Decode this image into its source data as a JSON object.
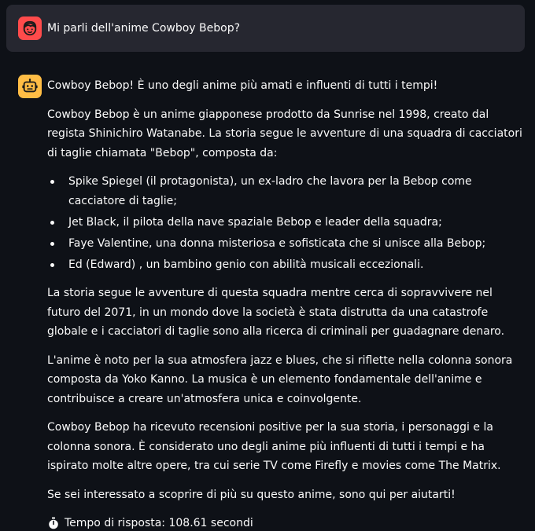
{
  "user_message": {
    "avatar_icon": "user-face-icon",
    "avatar_color": "#ff4b4b",
    "text": "Mi parli dell'anime Cowboy Bebop?"
  },
  "assistant_message": {
    "avatar_icon": "robot-face-icon",
    "avatar_color": "#ffbd45",
    "intro": "Cowboy Bebop! È uno degli anime più amati e influenti di tutti i tempi!",
    "paragraph_1": "Cowboy Bebop è un anime giapponese prodotto da Sunrise nel 1998, creato dal regista Shinichiro Watanabe. La storia segue le avventure di una squadra di cacciatori di taglie chiamata \"Bebop\", composta da:",
    "crew": [
      "Spike Spiegel (il protagonista), un ex-ladro che lavora per la Bebop come cacciatore di taglie;",
      "Jet Black, il pilota della nave spaziale Bebop e leader della squadra;",
      "Faye Valentine, una donna misteriosa e sofisticata che si unisce alla Bebop;",
      "Ed (Edward) , un bambino genio con abilità musicali eccezionali."
    ],
    "paragraph_2": "La storia segue le avventure di questa squadra mentre cerca di sopravvivere nel futuro del 2071, in un mondo dove la società è stata distrutta da una catastrofe globale e i cacciatori di taglie sono alla ricerca di criminali per guadagnare denaro.",
    "paragraph_3": "L'anime è noto per la sua atmosfera jazz e blues, che si riflette nella colonna sonora composta da Yoko Kanno. La musica è un elemento fondamentale dell'anime e contribuisce a creare un'atmosfera unica e coinvolgente.",
    "paragraph_4": "Cowboy Bebop ha ricevuto recensioni positive per la sua storia, i personaggi e la colonna sonora. È considerato uno degli anime più influenti di tutti i tempi e ha ispirato molte altre opere, tra cui serie TV come Firefly e movies come The Matrix.",
    "closing": "Se sei interessato a scoprire di più su questo anime, sono qui per aiutarti!",
    "timing_icon": "stopwatch-icon",
    "response_time": "Tempo di risposta: 108.61 secondi"
  }
}
